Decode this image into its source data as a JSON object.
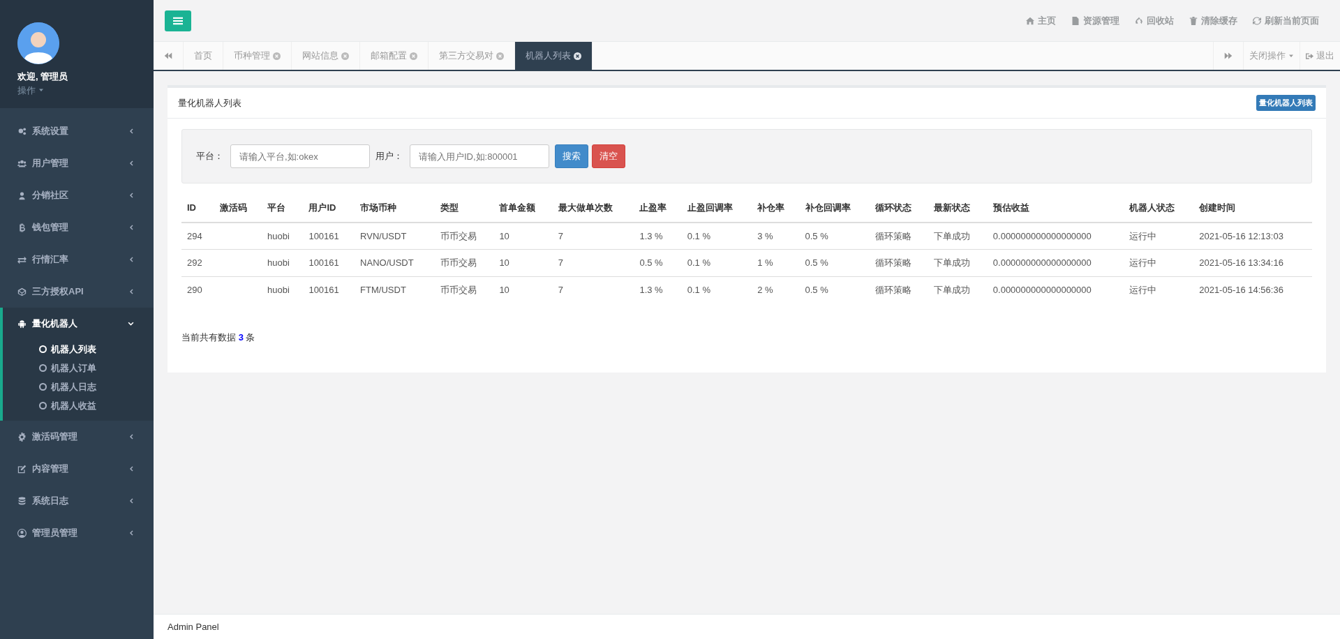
{
  "user": {
    "greeting": "欢迎, 管理员",
    "menu": "操作"
  },
  "sidebar": {
    "items": [
      {
        "label": "系统设置",
        "expanded": false
      },
      {
        "label": "用户管理",
        "expanded": false
      },
      {
        "label": "分销社区",
        "expanded": false
      },
      {
        "label": "钱包管理",
        "expanded": false
      },
      {
        "label": "行情汇率",
        "expanded": false
      },
      {
        "label": "三方授权API",
        "expanded": false
      },
      {
        "label": "量化机器人",
        "expanded": true,
        "children": [
          {
            "label": "机器人列表",
            "selected": true
          },
          {
            "label": "机器人订单",
            "selected": false
          },
          {
            "label": "机器人日志",
            "selected": false
          },
          {
            "label": "机器人收益",
            "selected": false
          }
        ]
      },
      {
        "label": "激活码管理",
        "expanded": false
      },
      {
        "label": "内容管理",
        "expanded": false
      },
      {
        "label": "系统日志",
        "expanded": false
      },
      {
        "label": "管理员管理",
        "expanded": false
      }
    ]
  },
  "header": {
    "links": [
      "主页",
      "资源管理",
      "回收站",
      "清除缓存",
      "刷新当前页面"
    ]
  },
  "tabs": [
    {
      "label": "首页",
      "selected": false,
      "closable": false
    },
    {
      "label": "币种管理",
      "selected": false,
      "closable": true
    },
    {
      "label": "网站信息",
      "selected": false,
      "closable": true
    },
    {
      "label": "邮箱配置",
      "selected": false,
      "closable": true
    },
    {
      "label": "第三方交易对",
      "selected": false,
      "closable": true
    },
    {
      "label": "机器人列表",
      "selected": true,
      "closable": true
    }
  ],
  "tab_actions": {
    "close_menu": "关闭操作",
    "logout": "退出"
  },
  "panel": {
    "title": "量化机器人列表",
    "badge": "量化机器人列表"
  },
  "search": {
    "fields": [
      {
        "label": "平台：",
        "placeholder": "请输入平台,如:okex"
      },
      {
        "label": "用户：",
        "placeholder": "请输入用户ID,如:800001"
      }
    ],
    "buttons": [
      {
        "label": "搜索",
        "kind": "primary"
      },
      {
        "label": "清空",
        "kind": "danger"
      }
    ]
  },
  "table": {
    "columns": [
      "ID",
      "激活码",
      "平台",
      "用户ID",
      "市场币种",
      "类型",
      "首单金额",
      "最大做单次数",
      "止盈率",
      "止盈回调率",
      "补仓率",
      "补仓回调率",
      "循环状态",
      "最新状态",
      "预估收益",
      "机器人状态",
      "创建时间"
    ],
    "rows": [
      [
        "294",
        "",
        "huobi",
        "100161",
        "RVN/USDT",
        "币币交易",
        "10",
        "7",
        "1.3 %",
        "0.1 %",
        "3 %",
        "0.5 %",
        "循环策略",
        "下单成功",
        "0.000000000000000000",
        "运行中",
        "2021-05-16 12:13:03"
      ],
      [
        "292",
        "",
        "huobi",
        "100161",
        "NANO/USDT",
        "币币交易",
        "10",
        "7",
        "0.5 %",
        "0.1 %",
        "1 %",
        "0.5 %",
        "循环策略",
        "下单成功",
        "0.000000000000000000",
        "运行中",
        "2021-05-16 13:34:16"
      ],
      [
        "290",
        "",
        "huobi",
        "100161",
        "FTM/USDT",
        "币币交易",
        "10",
        "7",
        "1.3 %",
        "0.1 %",
        "2 %",
        "0.5 %",
        "循环策略",
        "下单成功",
        "0.000000000000000000",
        "运行中",
        "2021-05-16 14:56:36"
      ]
    ]
  },
  "summary": {
    "prefix": "当前共有数据",
    "count": "3",
    "suffix": "条"
  },
  "footer": "Admin Panel"
}
